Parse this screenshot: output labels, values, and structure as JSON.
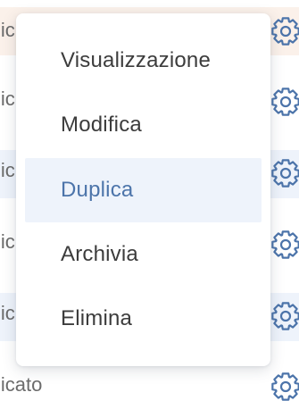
{
  "background_rows": [
    {
      "partial_text": "lic",
      "bg": "#fbf1ea"
    },
    {
      "partial_text": "lic",
      "bg": "#ffffff"
    },
    {
      "partial_text": "lic",
      "bg": "#eef3fb"
    },
    {
      "partial_text": "lic",
      "bg": "#ffffff"
    },
    {
      "partial_text": "lic",
      "bg": "#eef3fb"
    },
    {
      "partial_text": "licato",
      "bg": "#ffffff"
    }
  ],
  "context_menu": {
    "items": [
      {
        "label": "Visualizzazione",
        "active": false
      },
      {
        "label": "Modifica",
        "active": false
      },
      {
        "label": "Duplica",
        "active": true
      },
      {
        "label": "Archivia",
        "active": false
      },
      {
        "label": "Elimina",
        "active": false
      }
    ]
  },
  "colors": {
    "accent": "#4c74aa",
    "active_bg": "#eef3fb",
    "gear_icon": "#4c74aa"
  },
  "icons": {
    "row_action": "gear-icon"
  }
}
